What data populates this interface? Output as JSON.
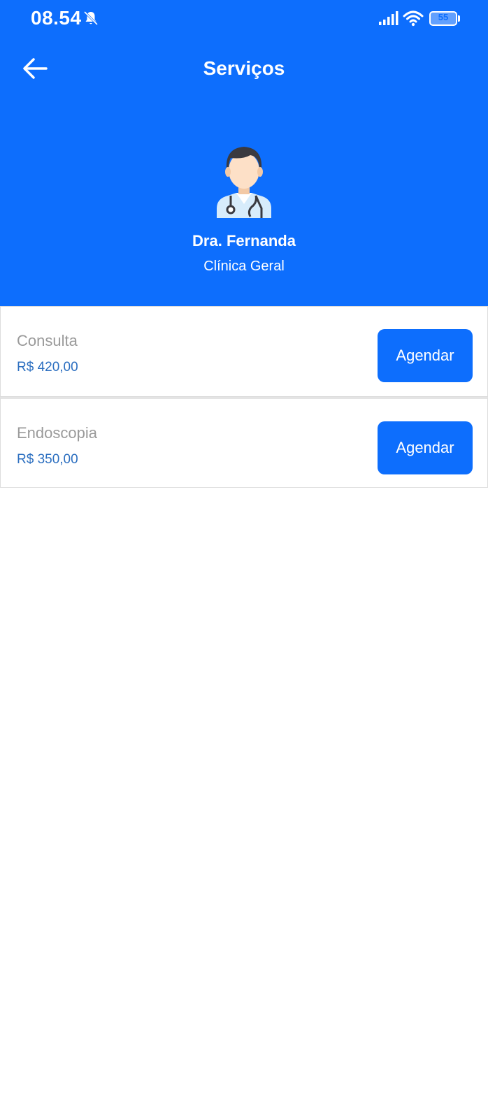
{
  "status_bar": {
    "time": "08.54",
    "battery": "55",
    "icons": [
      "bell-off-icon",
      "signal-icon",
      "wifi-icon",
      "battery-icon"
    ]
  },
  "header": {
    "title": "Serviços",
    "back_icon": "arrow-left-icon"
  },
  "doctor": {
    "avatar_icon": "doctor-avatar-icon",
    "name": "Dra. Fernanda",
    "specialty": "Clínica Geral"
  },
  "services": [
    {
      "name": "Consulta",
      "price": "R$ 420,00",
      "action_label": "Agendar"
    },
    {
      "name": "Endoscopia",
      "price": "R$ 350,00",
      "action_label": "Agendar"
    }
  ],
  "colors": {
    "primary": "#0d6efd",
    "price": "#2c6fc0",
    "service_name": "#9a9a9a"
  }
}
